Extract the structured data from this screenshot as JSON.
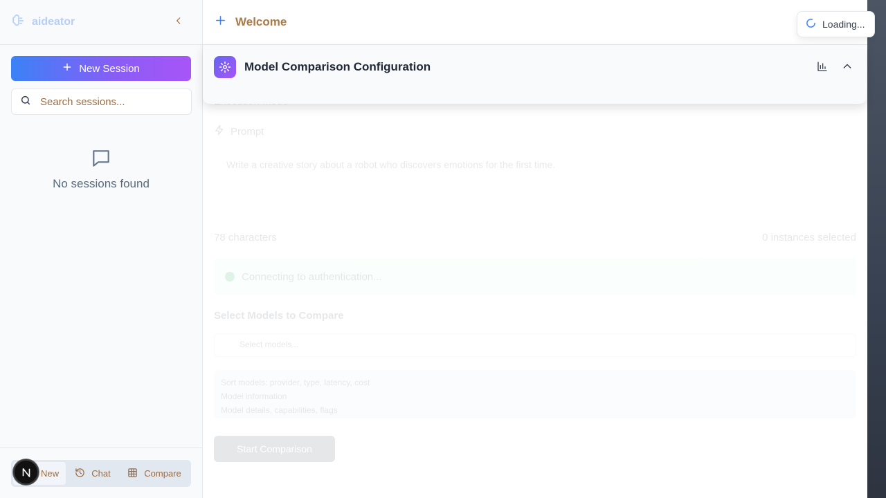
{
  "sidebar": {
    "brand": "aideator",
    "new_session_label": "New Session",
    "search_placeholder": "Search sessions...",
    "empty_text": "No sessions found",
    "footer_tabs": [
      {
        "label": "New",
        "icon": "plus-icon"
      },
      {
        "label": "Chat",
        "icon": "history-icon"
      },
      {
        "label": "Compare",
        "icon": "grid-icon"
      }
    ],
    "badge_letter": "N"
  },
  "topbar": {
    "title": "Welcome"
  },
  "config": {
    "title": "Model Comparison Configuration"
  },
  "background": {
    "execution_mode": "Execution Mode",
    "prompt_label": "Prompt",
    "prompt_text": "Write a creative story about a robot who discovers emotions for the first time.",
    "char_count": "78 characters",
    "instances": "0 instances selected",
    "status_text": "Connecting to authentication...",
    "select_models_heading": "Select Models to Compare",
    "select_placeholder": "Select models...",
    "info_lines": [
      "Sort models: provider, type, latency, cost",
      "Model information",
      "Model details, capabilities, flags"
    ],
    "run_button": "Start Comparison"
  },
  "toast": {
    "text": "Loading..."
  },
  "colors": {
    "accent_blue": "#3b82f6",
    "accent_purple": "#a855f7",
    "brown_text": "#a87a4a"
  }
}
